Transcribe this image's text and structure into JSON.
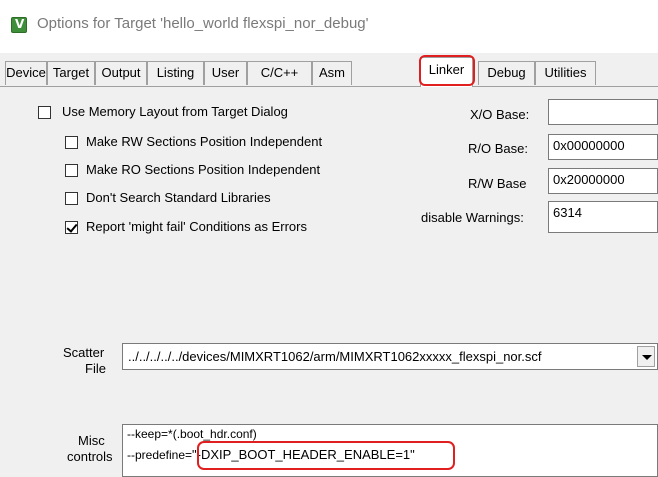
{
  "window": {
    "title": "Options for Target 'hello_world flexspi_nor_debug'"
  },
  "tabs": [
    {
      "label": "Device",
      "active": false
    },
    {
      "label": "Target",
      "active": false
    },
    {
      "label": "Output",
      "active": false
    },
    {
      "label": "Listing",
      "active": false
    },
    {
      "label": "User",
      "active": false
    },
    {
      "label": "C/C++",
      "active": false
    },
    {
      "label": "Asm",
      "active": false
    },
    {
      "label": "Linker",
      "active": true
    },
    {
      "label": "Debug",
      "active": false
    },
    {
      "label": "Utilities",
      "active": false
    }
  ],
  "linker": {
    "options": [
      {
        "label": "Use Memory Layout from Target Dialog",
        "checked": false
      },
      {
        "label": "Make RW Sections Position Independent",
        "checked": false
      },
      {
        "label": "Make RO Sections Position Independent",
        "checked": false
      },
      {
        "label": "Don't Search Standard Libraries",
        "checked": false
      },
      {
        "label": "Report 'might fail' Conditions as Errors",
        "checked": true
      }
    ],
    "xo_base": {
      "label": "X/O Base:",
      "value": ""
    },
    "ro_base": {
      "label": "R/O Base:",
      "value": "0x00000000"
    },
    "rw_base": {
      "label": "R/W Base",
      "value": "0x20000000"
    },
    "disable_warnings": {
      "label": "disable Warnings:",
      "value": "6314"
    },
    "scatter": {
      "label_line1": "Scatter",
      "label_line2": "File",
      "value": "../../../../../devices/MIMXRT1062/arm/MIMXRT1062xxxxx_flexspi_nor.scf"
    },
    "misc": {
      "label_line1": "Misc",
      "label_line2": "controls",
      "line1": "--keep=*(.boot_hdr.conf)",
      "line2_prefix": "--predefine=",
      "line2_value": "\"-DXIP_BOOT_HEADER_ENABLE=1\""
    }
  },
  "colors": {
    "highlight": "#e02020",
    "dialog_bg": "#f0f0f0"
  }
}
